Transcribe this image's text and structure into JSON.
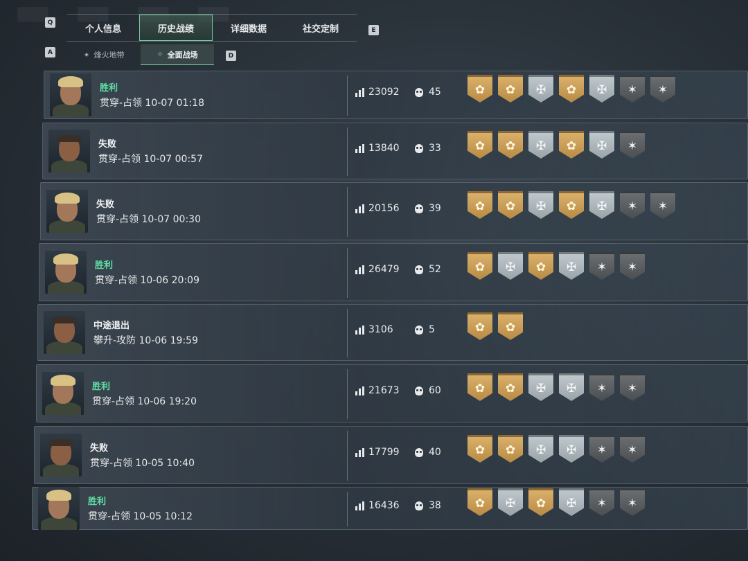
{
  "tabs": {
    "left_key": "Q",
    "right_key": "E",
    "items": [
      {
        "label": "个人信息",
        "active": false
      },
      {
        "label": "历史战绩",
        "active": true
      },
      {
        "label": "详细数据",
        "active": false
      },
      {
        "label": "社交定制",
        "active": false
      }
    ]
  },
  "subtabs": {
    "left_key": "A",
    "right_key": "D",
    "items": [
      {
        "label": "烽火地带",
        "icon": "warzone-icon",
        "active": false
      },
      {
        "label": "全面战场",
        "icon": "battlefield-icon",
        "active": true
      }
    ]
  },
  "colors": {
    "win": "#5fe0a6",
    "accent": "#76c9a4",
    "gold_medal": "#c99a55",
    "silver_medal": "#aeb7bb",
    "dark_medal": "#5a5e60"
  },
  "matches": [
    {
      "result": "胜利",
      "win": true,
      "mode": "贯穿-占领 10-07 01:18",
      "score": "23092",
      "kills": "45",
      "avatar": "blonde-operator",
      "medals": [
        "gold",
        "gold",
        "silver",
        "gold",
        "silver",
        "dark",
        "dark"
      ]
    },
    {
      "result": "失败",
      "win": false,
      "mode": "贯穿-占领 10-07 00:57",
      "score": "13840",
      "kills": "33",
      "avatar": "bald-operator",
      "medals": [
        "gold",
        "gold",
        "silver",
        "gold",
        "silver",
        "dark"
      ]
    },
    {
      "result": "失败",
      "win": false,
      "mode": "贯穿-占领 10-07 00:30",
      "score": "20156",
      "kills": "39",
      "avatar": "blonde-operator",
      "medals": [
        "gold",
        "gold",
        "silver",
        "gold",
        "silver",
        "dark",
        "dark"
      ]
    },
    {
      "result": "胜利",
      "win": true,
      "mode": "贯穿-占领 10-06 20:09",
      "score": "26479",
      "kills": "52",
      "avatar": "blonde-operator",
      "medals": [
        "gold",
        "silver",
        "gold",
        "silver",
        "dark",
        "dark"
      ]
    },
    {
      "result": "中途退出",
      "win": false,
      "mode": "攀升-攻防 10-06 19:59",
      "score": "3106",
      "kills": "5",
      "avatar": "bald-operator",
      "medals": [
        "gold",
        "gold"
      ]
    },
    {
      "result": "胜利",
      "win": true,
      "mode": "贯穿-占领 10-06 19:20",
      "score": "21673",
      "kills": "60",
      "avatar": "blonde-operator",
      "medals": [
        "gold",
        "gold",
        "silver",
        "silver",
        "dark",
        "dark"
      ]
    },
    {
      "result": "失败",
      "win": false,
      "mode": "贯穿-占领 10-05 10:40",
      "score": "17799",
      "kills": "40",
      "avatar": "bald-operator",
      "medals": [
        "gold",
        "gold",
        "silver",
        "silver",
        "dark",
        "dark"
      ]
    },
    {
      "result": "胜利",
      "win": true,
      "mode": "贯穿-占领 10-05 10:12",
      "score": "16436",
      "kills": "38",
      "avatar": "blonde-operator",
      "medals": [
        "gold",
        "silver",
        "gold",
        "silver",
        "dark",
        "dark"
      ]
    }
  ]
}
